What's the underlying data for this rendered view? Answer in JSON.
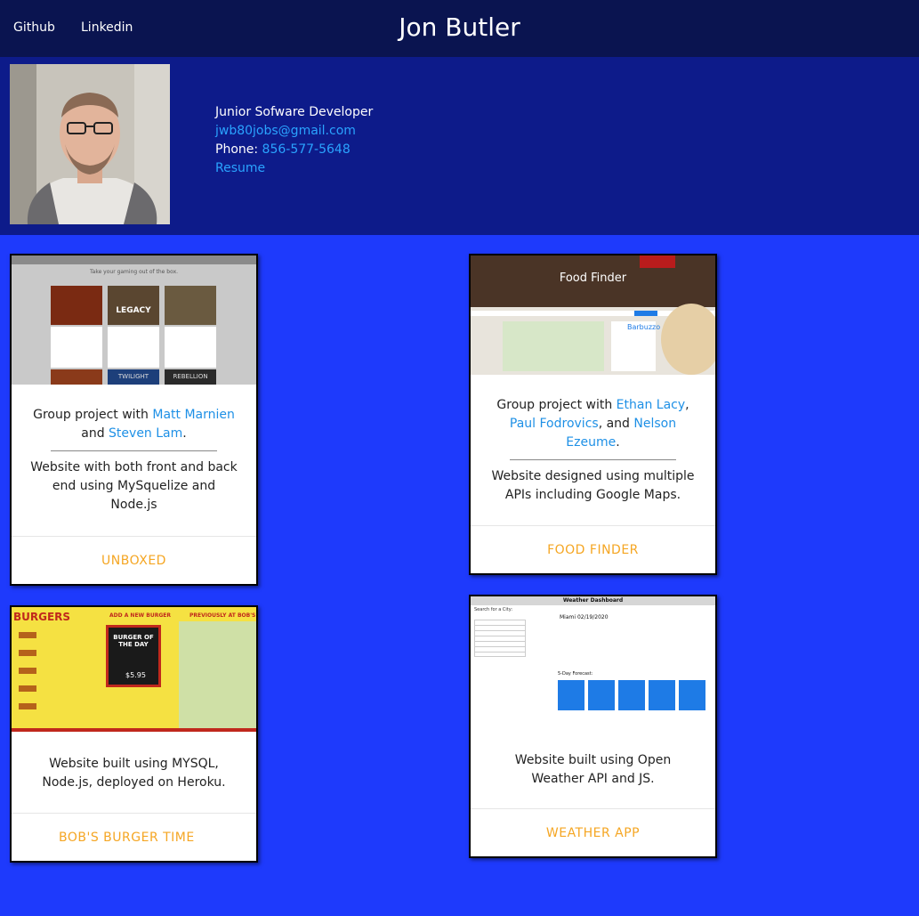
{
  "nav": {
    "github": "Github",
    "linkedin": "Linkedin",
    "brand": "Jon Butler"
  },
  "profile": {
    "title": "Junior Sofware Developer",
    "email": "jwb80jobs@gmail.com",
    "phone_label": "Phone:",
    "phone": "856-577-5648",
    "resume": "Resume"
  },
  "cards": {
    "unboxed": {
      "thumb_caption": "Take your gaming out of the box.",
      "game1": "LEGACY",
      "game2": "REBELLION",
      "game3": "TWILIGHT",
      "intro": "Group project with ",
      "p1": "Matt Marnien",
      "and": " and ",
      "p2": "Steven Lam",
      "end": ".",
      "desc": "Website with both front and back end using MySquelize and Node.js",
      "action": "UNBOXED"
    },
    "food": {
      "thumb_title": "Food Finder",
      "thumb_place": "Barbuzzo",
      "intro": "Group project with ",
      "p1": "Ethan Lacy",
      "sep": ", ",
      "p2": "Paul Fodrovics",
      "and": ", and ",
      "p3": "Nelson Ezeume",
      "end": ".",
      "desc": "Website designed using multiple APIs including Google Maps.",
      "action": "FOOD FINDER"
    },
    "burger": {
      "thumb_logo": "BURGERS",
      "thumb_add": "ADD A NEW BURGER",
      "thumb_right": "PREVIOUSLY AT BOB'S",
      "thumb_board": "BURGER OF THE DAY",
      "thumb_price": "$5.95",
      "desc": "Website built using MYSQL, Node.js, deployed on Heroku.",
      "action": "BOB'S BURGER TIME"
    },
    "weather": {
      "thumb_title": "Weather Dashboard",
      "thumb_search": "Search for a City:",
      "thumb_city": "Miami 02/19/2020",
      "thumb_forecast": "5-Day Forecast:",
      "desc": "Website built using Open Weather API and JS.",
      "action": "WEATHER APP"
    }
  }
}
